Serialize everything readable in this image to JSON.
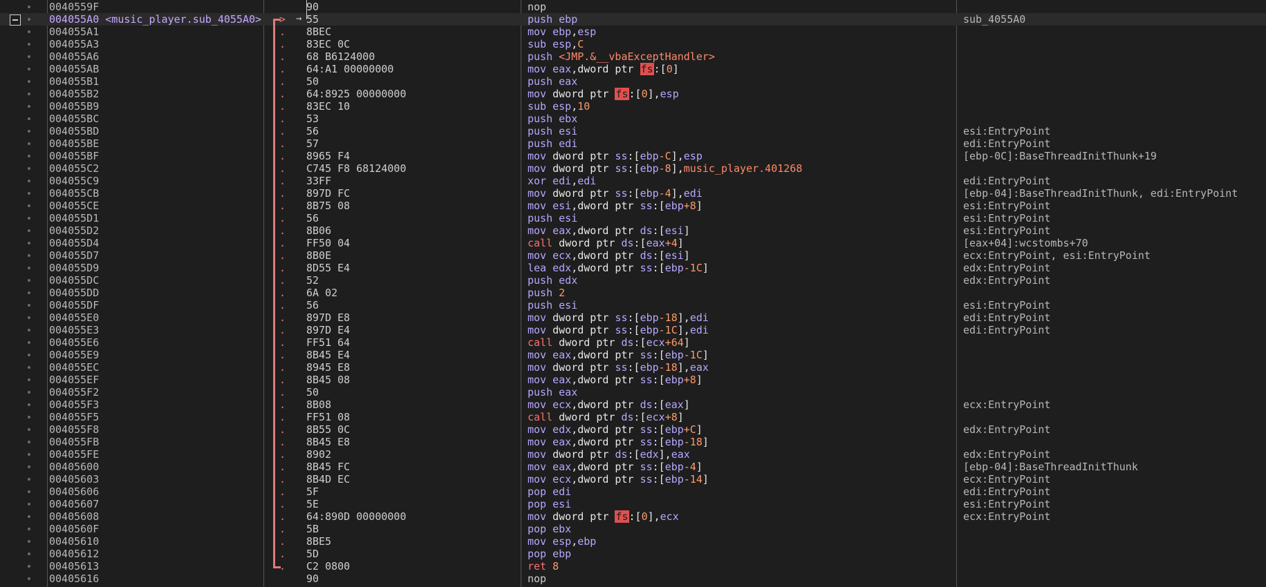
{
  "function_label": "sub_4055A0",
  "rows": [
    {
      "addr": "0040559F",
      "bytes": "90",
      "asm": [
        [
          "op-nop",
          "nop"
        ]
      ],
      "cmt": "",
      "dot": ""
    },
    {
      "addr": "004055A0 <music_player.sub_4055A0>",
      "bytes": "55",
      "asm": [
        [
          "op-push",
          "push "
        ],
        [
          "reg",
          "ebp"
        ]
      ],
      "cmt": "sub_4055A0",
      "dot": ">",
      "current": true
    },
    {
      "addr": "004055A1",
      "bytes": "8BEC",
      "asm": [
        [
          "op-mov",
          "mov "
        ],
        [
          "reg",
          "ebp"
        ],
        [
          "kw",
          ","
        ],
        [
          "reg",
          "esp"
        ]
      ],
      "cmt": "",
      "dot": "."
    },
    {
      "addr": "004055A3",
      "bytes": "83EC 0C",
      "asm": [
        [
          "op-mov",
          "sub "
        ],
        [
          "reg",
          "esp"
        ],
        [
          "kw",
          ","
        ],
        [
          "num",
          "C"
        ]
      ],
      "cmt": "",
      "dot": "."
    },
    {
      "addr": "004055A6",
      "bytes": "68 B6124000",
      "asm": [
        [
          "op-push",
          "push "
        ],
        [
          "sym",
          "<JMP.&__vbaExceptHandler>"
        ]
      ],
      "cmt": "",
      "dot": "."
    },
    {
      "addr": "004055AB",
      "bytes": "64:A1 00000000",
      "asm": [
        [
          "op-mov",
          "mov "
        ],
        [
          "reg",
          "eax"
        ],
        [
          "kw",
          ",dword ptr "
        ],
        [
          "fs",
          "fs"
        ],
        [
          "kw",
          ":["
        ],
        [
          "num",
          "0"
        ],
        [
          "kw",
          "]"
        ]
      ],
      "cmt": "",
      "dot": "."
    },
    {
      "addr": "004055B1",
      "bytes": "50",
      "asm": [
        [
          "op-push",
          "push "
        ],
        [
          "reg",
          "eax"
        ]
      ],
      "cmt": "",
      "dot": "."
    },
    {
      "addr": "004055B2",
      "bytes": "64:8925 00000000",
      "asm": [
        [
          "op-mov",
          "mov "
        ],
        [
          "kw",
          "dword ptr "
        ],
        [
          "fs",
          "fs"
        ],
        [
          "kw",
          ":["
        ],
        [
          "num",
          "0"
        ],
        [
          "kw",
          "],"
        ],
        [
          "reg",
          "esp"
        ]
      ],
      "cmt": "",
      "dot": "."
    },
    {
      "addr": "004055B9",
      "bytes": "83EC 10",
      "asm": [
        [
          "op-mov",
          "sub "
        ],
        [
          "reg",
          "esp"
        ],
        [
          "kw",
          ","
        ],
        [
          "num",
          "10"
        ]
      ],
      "cmt": "",
      "dot": "."
    },
    {
      "addr": "004055BC",
      "bytes": "53",
      "asm": [
        [
          "op-push",
          "push "
        ],
        [
          "reg",
          "ebx"
        ]
      ],
      "cmt": "",
      "dot": "."
    },
    {
      "addr": "004055BD",
      "bytes": "56",
      "asm": [
        [
          "op-push",
          "push "
        ],
        [
          "reg",
          "esi"
        ]
      ],
      "cmt": "esi:EntryPoint",
      "dot": "."
    },
    {
      "addr": "004055BE",
      "bytes": "57",
      "asm": [
        [
          "op-push",
          "push "
        ],
        [
          "reg",
          "edi"
        ]
      ],
      "cmt": "edi:EntryPoint",
      "dot": "."
    },
    {
      "addr": "004055BF",
      "bytes": "8965 F4",
      "asm": [
        [
          "op-mov",
          "mov "
        ],
        [
          "kw",
          "dword ptr "
        ],
        [
          "seg",
          "ss"
        ],
        [
          "kw",
          ":["
        ],
        [
          "reg",
          "ebp"
        ],
        [
          "num",
          "-C"
        ],
        [
          "kw",
          "],"
        ],
        [
          "reg",
          "esp"
        ]
      ],
      "cmt": "[ebp-0C]:BaseThreadInitThunk+19",
      "dot": "."
    },
    {
      "addr": "004055C2",
      "bytes": "C745 F8 68124000",
      "asm": [
        [
          "op-mov",
          "mov "
        ],
        [
          "kw",
          "dword ptr "
        ],
        [
          "seg",
          "ss"
        ],
        [
          "kw",
          ":["
        ],
        [
          "reg",
          "ebp"
        ],
        [
          "num",
          "-8"
        ],
        [
          "kw",
          "],"
        ],
        [
          "sym",
          "music_player.401268"
        ]
      ],
      "cmt": "",
      "dot": "."
    },
    {
      "addr": "004055C9",
      "bytes": "33FF",
      "asm": [
        [
          "op-mov",
          "xor "
        ],
        [
          "reg",
          "edi"
        ],
        [
          "kw",
          ","
        ],
        [
          "reg",
          "edi"
        ]
      ],
      "cmt": "edi:EntryPoint",
      "dot": "."
    },
    {
      "addr": "004055CB",
      "bytes": "897D FC",
      "asm": [
        [
          "op-mov",
          "mov "
        ],
        [
          "kw",
          "dword ptr "
        ],
        [
          "seg",
          "ss"
        ],
        [
          "kw",
          ":["
        ],
        [
          "reg",
          "ebp"
        ],
        [
          "num",
          "-4"
        ],
        [
          "kw",
          "],"
        ],
        [
          "reg",
          "edi"
        ]
      ],
      "cmt": "[ebp-04]:BaseThreadInitThunk, edi:EntryPoint",
      "dot": "."
    },
    {
      "addr": "004055CE",
      "bytes": "8B75 08",
      "asm": [
        [
          "op-mov",
          "mov "
        ],
        [
          "reg",
          "esi"
        ],
        [
          "kw",
          ",dword ptr "
        ],
        [
          "seg",
          "ss"
        ],
        [
          "kw",
          ":["
        ],
        [
          "reg",
          "ebp"
        ],
        [
          "num",
          "+8"
        ],
        [
          "kw",
          "]"
        ]
      ],
      "cmt": "esi:EntryPoint",
      "dot": "."
    },
    {
      "addr": "004055D1",
      "bytes": "56",
      "asm": [
        [
          "op-push",
          "push "
        ],
        [
          "reg",
          "esi"
        ]
      ],
      "cmt": "esi:EntryPoint",
      "dot": "."
    },
    {
      "addr": "004055D2",
      "bytes": "8B06",
      "asm": [
        [
          "op-mov",
          "mov "
        ],
        [
          "reg",
          "eax"
        ],
        [
          "kw",
          ",dword ptr "
        ],
        [
          "seg",
          "ds"
        ],
        [
          "kw",
          ":["
        ],
        [
          "reg",
          "esi"
        ],
        [
          "kw",
          "]"
        ]
      ],
      "cmt": "esi:EntryPoint",
      "dot": "."
    },
    {
      "addr": "004055D4",
      "bytes": "FF50 04",
      "asm": [
        [
          "op-call",
          "call "
        ],
        [
          "kw",
          "dword ptr "
        ],
        [
          "seg",
          "ds"
        ],
        [
          "kw",
          ":["
        ],
        [
          "reg",
          "eax"
        ],
        [
          "num",
          "+4"
        ],
        [
          "kw",
          "]"
        ]
      ],
      "cmt": "[eax+04]:wcstombs+70",
      "dot": "."
    },
    {
      "addr": "004055D7",
      "bytes": "8B0E",
      "asm": [
        [
          "op-mov",
          "mov "
        ],
        [
          "reg",
          "ecx"
        ],
        [
          "kw",
          ",dword ptr "
        ],
        [
          "seg",
          "ds"
        ],
        [
          "kw",
          ":["
        ],
        [
          "reg",
          "esi"
        ],
        [
          "kw",
          "]"
        ]
      ],
      "cmt": "ecx:EntryPoint, esi:EntryPoint",
      "dot": "."
    },
    {
      "addr": "004055D9",
      "bytes": "8D55 E4",
      "asm": [
        [
          "op-mov",
          "lea "
        ],
        [
          "reg",
          "edx"
        ],
        [
          "kw",
          ",dword ptr "
        ],
        [
          "seg",
          "ss"
        ],
        [
          "kw",
          ":["
        ],
        [
          "reg",
          "ebp"
        ],
        [
          "num",
          "-1C"
        ],
        [
          "kw",
          "]"
        ]
      ],
      "cmt": "edx:EntryPoint",
      "dot": "."
    },
    {
      "addr": "004055DC",
      "bytes": "52",
      "asm": [
        [
          "op-push",
          "push "
        ],
        [
          "reg",
          "edx"
        ]
      ],
      "cmt": "edx:EntryPoint",
      "dot": "."
    },
    {
      "addr": "004055DD",
      "bytes": "6A 02",
      "asm": [
        [
          "op-push",
          "push "
        ],
        [
          "num",
          "2"
        ]
      ],
      "cmt": "",
      "dot": "."
    },
    {
      "addr": "004055DF",
      "bytes": "56",
      "asm": [
        [
          "op-push",
          "push "
        ],
        [
          "reg",
          "esi"
        ]
      ],
      "cmt": "esi:EntryPoint",
      "dot": "."
    },
    {
      "addr": "004055E0",
      "bytes": "897D E8",
      "asm": [
        [
          "op-mov",
          "mov "
        ],
        [
          "kw",
          "dword ptr "
        ],
        [
          "seg",
          "ss"
        ],
        [
          "kw",
          ":["
        ],
        [
          "reg",
          "ebp"
        ],
        [
          "num",
          "-18"
        ],
        [
          "kw",
          "],"
        ],
        [
          "reg",
          "edi"
        ]
      ],
      "cmt": "edi:EntryPoint",
      "dot": "."
    },
    {
      "addr": "004055E3",
      "bytes": "897D E4",
      "asm": [
        [
          "op-mov",
          "mov "
        ],
        [
          "kw",
          "dword ptr "
        ],
        [
          "seg",
          "ss"
        ],
        [
          "kw",
          ":["
        ],
        [
          "reg",
          "ebp"
        ],
        [
          "num",
          "-1C"
        ],
        [
          "kw",
          "],"
        ],
        [
          "reg",
          "edi"
        ]
      ],
      "cmt": "edi:EntryPoint",
      "dot": "."
    },
    {
      "addr": "004055E6",
      "bytes": "FF51 64",
      "asm": [
        [
          "op-call",
          "call "
        ],
        [
          "kw",
          "dword ptr "
        ],
        [
          "seg",
          "ds"
        ],
        [
          "kw",
          ":["
        ],
        [
          "reg",
          "ecx"
        ],
        [
          "num",
          "+64"
        ],
        [
          "kw",
          "]"
        ]
      ],
      "cmt": "",
      "dot": "."
    },
    {
      "addr": "004055E9",
      "bytes": "8B45 E4",
      "asm": [
        [
          "op-mov",
          "mov "
        ],
        [
          "reg",
          "eax"
        ],
        [
          "kw",
          ",dword ptr "
        ],
        [
          "seg",
          "ss"
        ],
        [
          "kw",
          ":["
        ],
        [
          "reg",
          "ebp"
        ],
        [
          "num",
          "-1C"
        ],
        [
          "kw",
          "]"
        ]
      ],
      "cmt": "",
      "dot": "."
    },
    {
      "addr": "004055EC",
      "bytes": "8945 E8",
      "asm": [
        [
          "op-mov",
          "mov "
        ],
        [
          "kw",
          "dword ptr "
        ],
        [
          "seg",
          "ss"
        ],
        [
          "kw",
          ":["
        ],
        [
          "reg",
          "ebp"
        ],
        [
          "num",
          "-18"
        ],
        [
          "kw",
          "],"
        ],
        [
          "reg",
          "eax"
        ]
      ],
      "cmt": "",
      "dot": "."
    },
    {
      "addr": "004055EF",
      "bytes": "8B45 08",
      "asm": [
        [
          "op-mov",
          "mov "
        ],
        [
          "reg",
          "eax"
        ],
        [
          "kw",
          ",dword ptr "
        ],
        [
          "seg",
          "ss"
        ],
        [
          "kw",
          ":["
        ],
        [
          "reg",
          "ebp"
        ],
        [
          "num",
          "+8"
        ],
        [
          "kw",
          "]"
        ]
      ],
      "cmt": "",
      "dot": "."
    },
    {
      "addr": "004055F2",
      "bytes": "50",
      "asm": [
        [
          "op-push",
          "push "
        ],
        [
          "reg",
          "eax"
        ]
      ],
      "cmt": "",
      "dot": "."
    },
    {
      "addr": "004055F3",
      "bytes": "8B08",
      "asm": [
        [
          "op-mov",
          "mov "
        ],
        [
          "reg",
          "ecx"
        ],
        [
          "kw",
          ",dword ptr "
        ],
        [
          "seg",
          "ds"
        ],
        [
          "kw",
          ":["
        ],
        [
          "reg",
          "eax"
        ],
        [
          "kw",
          "]"
        ]
      ],
      "cmt": "ecx:EntryPoint",
      "dot": "."
    },
    {
      "addr": "004055F5",
      "bytes": "FF51 08",
      "asm": [
        [
          "op-call",
          "call "
        ],
        [
          "kw",
          "dword ptr "
        ],
        [
          "seg",
          "ds"
        ],
        [
          "kw",
          ":["
        ],
        [
          "reg",
          "ecx"
        ],
        [
          "num",
          "+8"
        ],
        [
          "kw",
          "]"
        ]
      ],
      "cmt": "",
      "dot": "."
    },
    {
      "addr": "004055F8",
      "bytes": "8B55 0C",
      "asm": [
        [
          "op-mov",
          "mov "
        ],
        [
          "reg",
          "edx"
        ],
        [
          "kw",
          ",dword ptr "
        ],
        [
          "seg",
          "ss"
        ],
        [
          "kw",
          ":["
        ],
        [
          "reg",
          "ebp"
        ],
        [
          "num",
          "+C"
        ],
        [
          "kw",
          "]"
        ]
      ],
      "cmt": "edx:EntryPoint",
      "dot": "."
    },
    {
      "addr": "004055FB",
      "bytes": "8B45 E8",
      "asm": [
        [
          "op-mov",
          "mov "
        ],
        [
          "reg",
          "eax"
        ],
        [
          "kw",
          ",dword ptr "
        ],
        [
          "seg",
          "ss"
        ],
        [
          "kw",
          ":["
        ],
        [
          "reg",
          "ebp"
        ],
        [
          "num",
          "-18"
        ],
        [
          "kw",
          "]"
        ]
      ],
      "cmt": "",
      "dot": "."
    },
    {
      "addr": "004055FE",
      "bytes": "8902",
      "asm": [
        [
          "op-mov",
          "mov "
        ],
        [
          "kw",
          "dword ptr "
        ],
        [
          "seg",
          "ds"
        ],
        [
          "kw",
          ":["
        ],
        [
          "reg",
          "edx"
        ],
        [
          "kw",
          "],"
        ],
        [
          "reg",
          "eax"
        ]
      ],
      "cmt": "edx:EntryPoint",
      "dot": "."
    },
    {
      "addr": "00405600",
      "bytes": "8B45 FC",
      "asm": [
        [
          "op-mov",
          "mov "
        ],
        [
          "reg",
          "eax"
        ],
        [
          "kw",
          ",dword ptr "
        ],
        [
          "seg",
          "ss"
        ],
        [
          "kw",
          ":["
        ],
        [
          "reg",
          "ebp"
        ],
        [
          "num",
          "-4"
        ],
        [
          "kw",
          "]"
        ]
      ],
      "cmt": "[ebp-04]:BaseThreadInitThunk",
      "dot": "."
    },
    {
      "addr": "00405603",
      "bytes": "8B4D EC",
      "asm": [
        [
          "op-mov",
          "mov "
        ],
        [
          "reg",
          "ecx"
        ],
        [
          "kw",
          ",dword ptr "
        ],
        [
          "seg",
          "ss"
        ],
        [
          "kw",
          ":["
        ],
        [
          "reg",
          "ebp"
        ],
        [
          "num",
          "-14"
        ],
        [
          "kw",
          "]"
        ]
      ],
      "cmt": "ecx:EntryPoint",
      "dot": "."
    },
    {
      "addr": "00405606",
      "bytes": "5F",
      "asm": [
        [
          "op-push",
          "pop "
        ],
        [
          "reg",
          "edi"
        ]
      ],
      "cmt": "edi:EntryPoint",
      "dot": "."
    },
    {
      "addr": "00405607",
      "bytes": "5E",
      "asm": [
        [
          "op-push",
          "pop "
        ],
        [
          "reg",
          "esi"
        ]
      ],
      "cmt": "esi:EntryPoint",
      "dot": "."
    },
    {
      "addr": "00405608",
      "bytes": "64:890D 00000000",
      "asm": [
        [
          "op-mov",
          "mov "
        ],
        [
          "kw",
          "dword ptr "
        ],
        [
          "fs",
          "fs"
        ],
        [
          "kw",
          ":["
        ],
        [
          "num",
          "0"
        ],
        [
          "kw",
          "],"
        ],
        [
          "reg",
          "ecx"
        ]
      ],
      "cmt": "ecx:EntryPoint",
      "dot": "."
    },
    {
      "addr": "0040560F",
      "bytes": "5B",
      "asm": [
        [
          "op-push",
          "pop "
        ],
        [
          "reg",
          "ebx"
        ]
      ],
      "cmt": "",
      "dot": "."
    },
    {
      "addr": "00405610",
      "bytes": "8BE5",
      "asm": [
        [
          "op-mov",
          "mov "
        ],
        [
          "reg",
          "esp"
        ],
        [
          "kw",
          ","
        ],
        [
          "reg",
          "ebp"
        ]
      ],
      "cmt": "",
      "dot": "."
    },
    {
      "addr": "00405612",
      "bytes": "5D",
      "asm": [
        [
          "op-push",
          "pop "
        ],
        [
          "reg",
          "ebp"
        ]
      ],
      "cmt": "",
      "dot": "."
    },
    {
      "addr": "00405613",
      "bytes": "C2 0800",
      "asm": [
        [
          "op-ret",
          "ret "
        ],
        [
          "num",
          "8"
        ]
      ],
      "cmt": "",
      "dot": "."
    },
    {
      "addr": "00405616",
      "bytes": "90",
      "asm": [
        [
          "op-nop",
          "nop"
        ]
      ],
      "cmt": "",
      "dot": ""
    }
  ]
}
